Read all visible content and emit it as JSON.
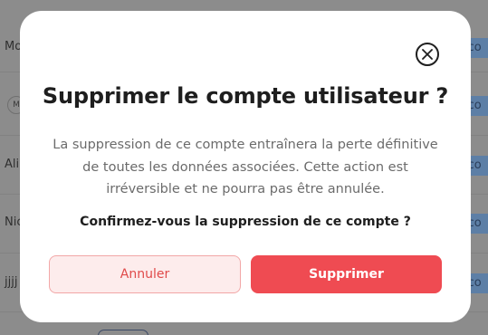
{
  "background": {
    "rows": [
      {
        "name": "Mo",
        "action": "ico"
      },
      {
        "name": "M",
        "action": "ico"
      },
      {
        "name": "Ali",
        "action": "ico"
      },
      {
        "name": "Nic",
        "action": "ico"
      },
      {
        "name": "jjjj",
        "action": "ico"
      }
    ]
  },
  "modal": {
    "title": "Supprimer le compte utilisateur ?",
    "description": "La suppression de ce compte entraînera la perte définitive de toutes les données associées. Cette action est irréversible et ne pourra pas être annulée.",
    "confirm_question": "Confirmez-vous la suppression de ce compte ?",
    "cancel_label": "Annuler",
    "delete_label": "Supprimer",
    "close_icon": "close-icon"
  },
  "colors": {
    "overlay": "#8c8c8c",
    "modal_bg": "#ffffff",
    "danger": "#ef4b52",
    "danger_light": "#fdecec",
    "text_dark": "#1e1e1e",
    "text_muted": "#6b6b6b"
  }
}
